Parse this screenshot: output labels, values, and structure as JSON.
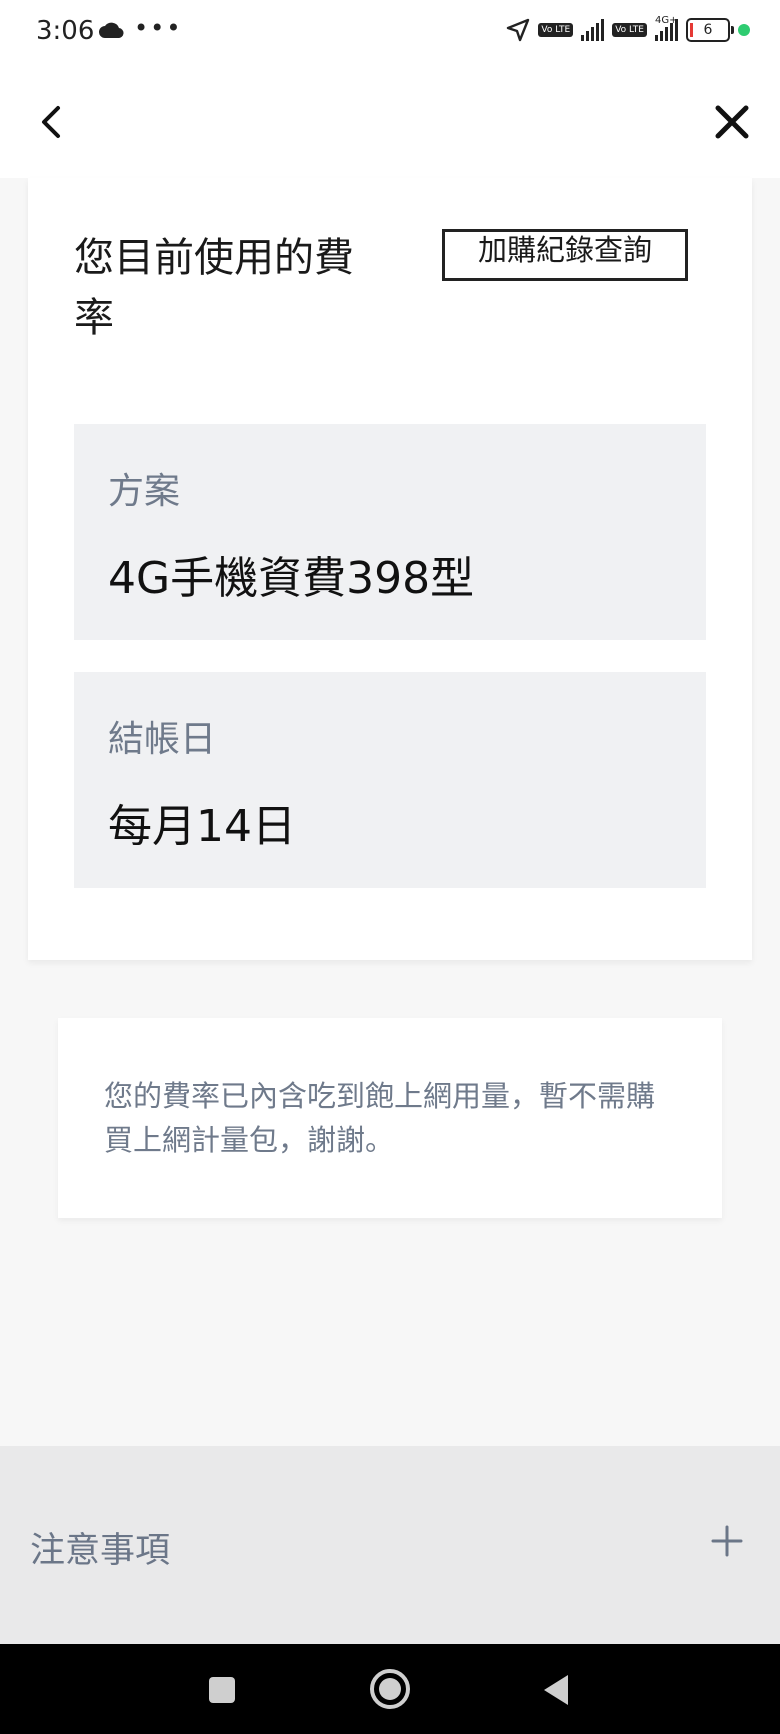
{
  "status_bar": {
    "time": "3:06",
    "icons": [
      "cloud-icon",
      "more-dots-icon",
      "location-arrow-icon",
      "volte-icon",
      "signal-icon",
      "volte-icon",
      "signal-4g-icon",
      "battery-icon"
    ],
    "volte_label": "Vo LTE",
    "network_label": "4G+",
    "battery_level": "6"
  },
  "header": {
    "back_icon": "chevron-left-icon",
    "close_icon": "close-icon"
  },
  "rate_card": {
    "title": "您目前使用的費率",
    "history_button": "加購紀錄查詢",
    "plan_label": "方案",
    "plan_value": "4G手機資費398型",
    "billing_label": "結帳日",
    "billing_value": "每月14日"
  },
  "notice": {
    "text": "您的費率已內含吃到飽上網用量，暫不需購買上網計量包，謝謝。"
  },
  "notes": {
    "label": "注意事項",
    "expand_icon": "plus-icon"
  },
  "nav": {
    "icons": [
      "recents-square-icon",
      "home-circle-icon",
      "back-triangle-icon"
    ]
  },
  "colors": {
    "accent_text": "#6f7a8b",
    "info_bg": "#f0f1f3",
    "notes_bg": "#e9e9ea",
    "status_dot": "#2ecc71"
  }
}
